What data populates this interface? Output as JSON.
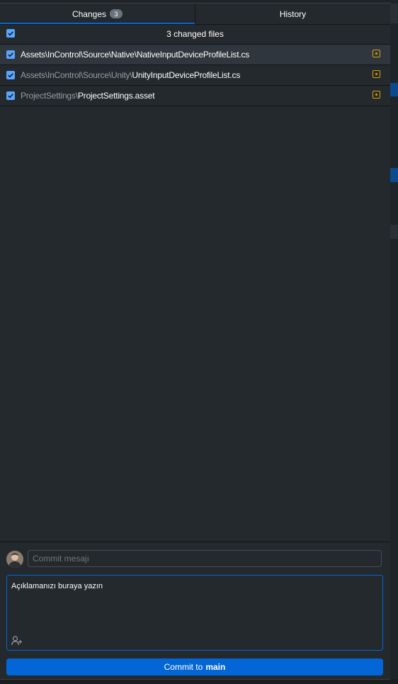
{
  "tabs": [
    {
      "label": "Changes",
      "badge": "3",
      "active": true
    },
    {
      "label": "History",
      "active": false
    }
  ],
  "list_header": {
    "summary": "3 changed files",
    "all_checked": true
  },
  "files": [
    {
      "dir": "Assets\\InControl\\Source\\Native\\",
      "name": "NativeInputDeviceProfileList.cs",
      "checked": true,
      "status": "modified",
      "selected": true
    },
    {
      "dir": "Assets\\InControl\\Source\\Unity\\",
      "name": "UnityInputDeviceProfileList.cs",
      "checked": true,
      "status": "modified",
      "selected": false
    },
    {
      "dir": "ProjectSettings\\",
      "name": "ProjectSettings.asset",
      "checked": true,
      "status": "modified",
      "selected": false
    }
  ],
  "commit": {
    "summary_placeholder": "Commit mesajı",
    "description_placeholder": "Açıklamanızı buraya yazın",
    "button_prefix": "Commit to",
    "branch": "main"
  },
  "colors": {
    "accent": "#0366d6",
    "checkbox": "#58a6ff",
    "modified": "#d8a107",
    "background": "#24292e"
  }
}
